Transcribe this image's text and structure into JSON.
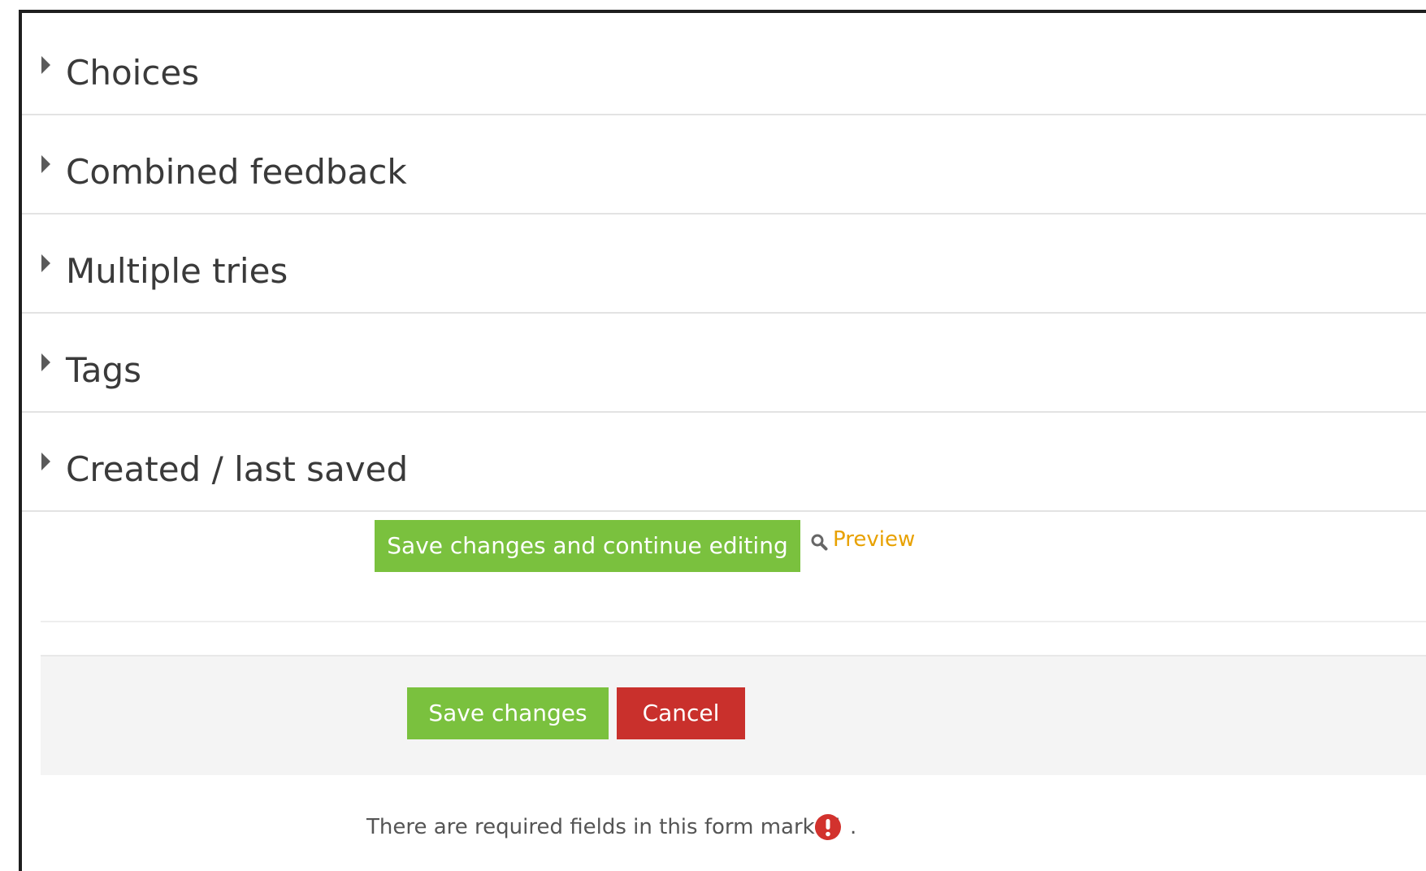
{
  "sections": [
    {
      "label": "Choices"
    },
    {
      "label": "Combined feedback"
    },
    {
      "label": "Multiple tries"
    },
    {
      "label": "Tags"
    },
    {
      "label": "Created / last saved"
    }
  ],
  "actions": {
    "save_continue_label": "Save changes and continue editing",
    "preview_label": "Preview",
    "save_label": "Save changes",
    "cancel_label": "Cancel"
  },
  "footer": {
    "required_note": "There are required fields in this form marked",
    "trailing_dot": "."
  },
  "colors": {
    "primary_green": "#7ac13e",
    "danger_red": "#c9302c",
    "link_orange": "#e8a100",
    "required_red": "#d2322d"
  },
  "icons": {
    "section_toggle": "caret-right-icon",
    "preview": "search-icon",
    "required": "exclamation-circle-icon"
  }
}
